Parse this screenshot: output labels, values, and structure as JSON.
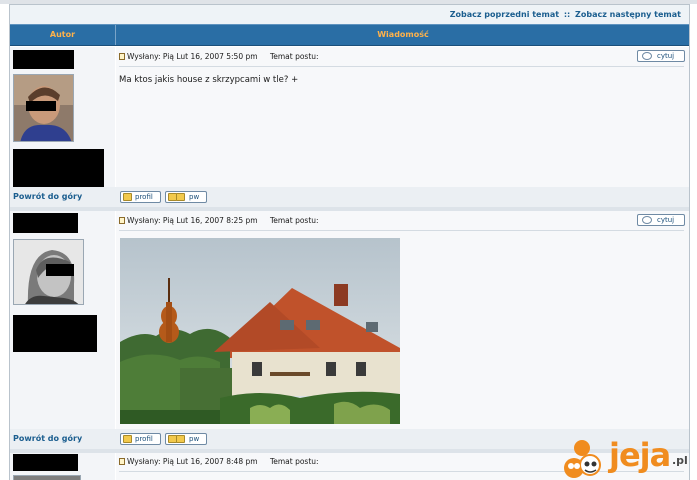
{
  "topnav": {
    "prev_topic": "Zobacz poprzedni temat",
    "separator": "::",
    "next_topic": "Zobacz następny temat"
  },
  "table_header": {
    "author": "Autor",
    "message": "Wiadomość"
  },
  "post_labels": {
    "posted": "Wysłany:",
    "subject": "Temat postu:",
    "quote": "cytuj",
    "back_to_top": "Powrót do góry",
    "profile": "profil",
    "pm": "pw"
  },
  "posts": [
    {
      "date": "Pią Lut 16, 2007 5:50 pm",
      "text": "Ma ktos jakis house z skrzypcami w tle? +"
    },
    {
      "date": "Pią Lut 16, 2007 8:25 pm"
    },
    {
      "date": "Pią Lut 16, 2007 8:48 pm"
    }
  ],
  "watermark": {
    "brand": "jeja",
    "tld": ".pl"
  },
  "colors": {
    "header_blue": "#2a6ea5",
    "header_text": "#ffb24a",
    "link_blue": "#1b5e8f",
    "watermark_orange": "#f08c1f"
  }
}
